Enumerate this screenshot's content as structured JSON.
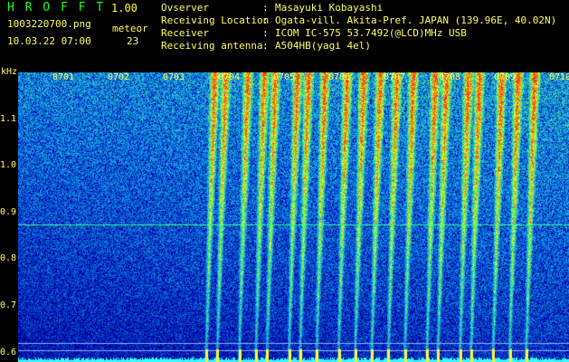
{
  "header": {
    "app_title": "H R O F F T",
    "version": "1.00",
    "filename": "1003220700.png",
    "meteor_label": "meteor",
    "meteor_count": "23",
    "datetime": "10.03.22 07:00"
  },
  "info": [
    {
      "key": "Ovserver",
      "sep": ":",
      "value": "Masayuki Kobayashi"
    },
    {
      "key": "Receiving Location",
      "sep": ":",
      "value": "Ogata-vill. Akita-Pref. JAPAN (139.96E, 40.02N)"
    },
    {
      "key": "Receiver",
      "sep": ":",
      "value": "ICOM IC-575 53.7492(@LCD)MHz USB"
    },
    {
      "key": "Receiving antenna",
      "sep": ":",
      "value": "A504HB(yagi 4el)"
    }
  ],
  "axis": {
    "y_unit": "kHz",
    "y_ticks": [
      "1.1",
      "1.0",
      "0.9",
      "0.8",
      "0.7",
      "0.6"
    ],
    "x_ticks": [
      "0701",
      "0702",
      "0703",
      "0704",
      "0705",
      "0706",
      "0707",
      "0708",
      "0709",
      "0710"
    ]
  },
  "colors": {
    "background": "#000000",
    "label_yellow": "#ffff66",
    "title_green": "#19ff19",
    "noise_blue": "#1c3bcc",
    "signal_green": "#33ff66",
    "signal_red": "#ff3333",
    "baseline_cyan": "#33ffff"
  },
  "chart_data": {
    "type": "heatmap",
    "title": "",
    "xlabel": "",
    "ylabel": "kHz",
    "x_categories": [
      "0701",
      "0702",
      "0703",
      "0704",
      "0705",
      "0706",
      "0707",
      "0708",
      "0709",
      "0710"
    ],
    "ylim": [
      0.58,
      1.2
    ],
    "y_ticks": [
      1.1,
      1.0,
      0.9,
      0.8,
      0.7,
      0.6
    ],
    "horizontal_lines_khz": [
      0.875,
      0.62,
      0.605
    ],
    "meteor_trails_minute": [
      4.1,
      4.3,
      4.7,
      5.0,
      5.2,
      5.6,
      5.8,
      6.1,
      6.5,
      6.8,
      7.1,
      7.4,
      7.7,
      8.1,
      8.3,
      8.7,
      8.9,
      9.3,
      9.6,
      9.9
    ]
  }
}
